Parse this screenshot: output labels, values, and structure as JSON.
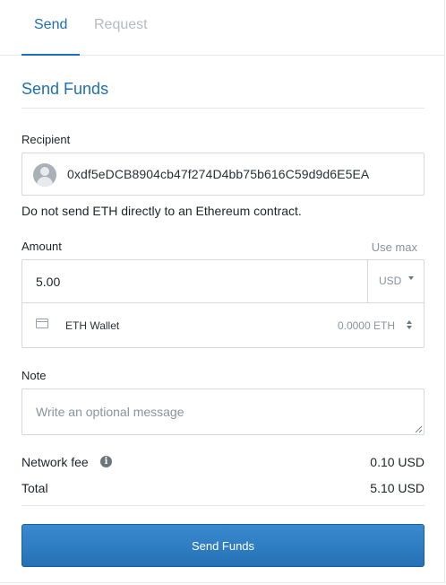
{
  "tabs": {
    "send": "Send",
    "request": "Request"
  },
  "form": {
    "title": "Send Funds",
    "recipient": {
      "label": "Recipient",
      "address": "0xdf5eDCB8904cb47f274D4bb75b616C59d9d6E5EA",
      "warning": "Do not send ETH directly to an Ethereum contract."
    },
    "amount": {
      "label": "Amount",
      "use_max": "Use max",
      "value": "5.00",
      "currency": "USD",
      "wallet_name": "ETH Wallet",
      "wallet_balance": "0.0000 ETH"
    },
    "note": {
      "label": "Note",
      "placeholder": "Write an optional message"
    },
    "fees": {
      "network_fee_label": "Network fee",
      "network_fee_value": "0.10 USD",
      "total_label": "Total",
      "total_value": "5.10 USD"
    },
    "submit_label": "Send Funds"
  },
  "icons": {
    "avatar": "user-avatar-icon",
    "wallet": "wallet-icon",
    "info": "info-icon",
    "currency_caret": "chevron-down-icon",
    "wallet_selector": "up-down-chevron-icon"
  },
  "colors": {
    "accent": "#1f6fb5",
    "button": "#2c7cc2",
    "muted": "#8b939b",
    "border": "#d5d9dd"
  }
}
